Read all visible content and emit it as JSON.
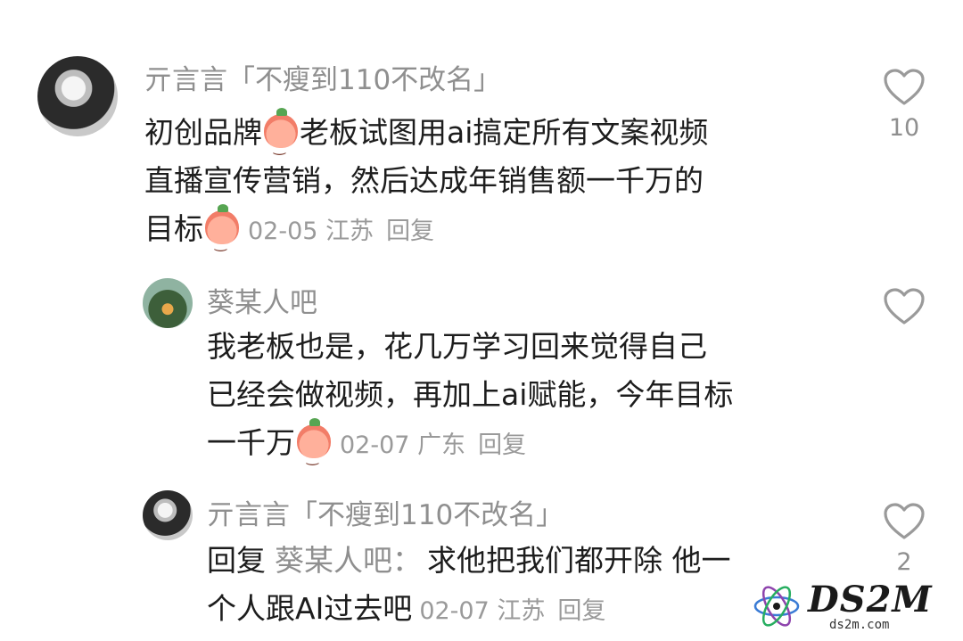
{
  "comments": [
    {
      "author": "亓言言「不瘦到110不改名」",
      "lines": [
        "初创品牌",
        "老板试图用ai搞定所有文案视频",
        "直播宣传营销，然后达成年销售额一千万的",
        "目标"
      ],
      "date": "02-05",
      "location": "江苏",
      "reply_label": "回复",
      "likes": "10",
      "emoji": "peach-emoji"
    },
    {
      "author": "葵某人吧",
      "lines": [
        "我老板也是，花几万学习回来觉得自己",
        "已经会做视频，再加上ai赋能，今年目标",
        "一千万"
      ],
      "date": "02-07",
      "location": "广东",
      "reply_label": "回复",
      "likes": ""
    },
    {
      "author": "亓言言「不瘦到110不改名」",
      "reply_prefix": "回复",
      "reply_to": "葵某人吧：",
      "lines": [
        "求他把我们都开除 他一",
        "个人跟AI过去吧"
      ],
      "date": "02-07",
      "location": "江苏",
      "reply_label": "回复",
      "likes": "2"
    }
  ],
  "watermark": {
    "title": "DS2M",
    "subtitle": "ds2m.com"
  },
  "colors": {
    "text": "#1d1d1d",
    "muted": "#8f8f8f",
    "background": "#ffffff"
  }
}
